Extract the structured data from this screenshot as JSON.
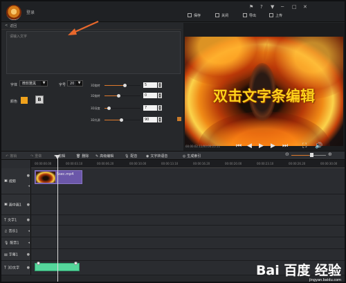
{
  "window": {
    "app_name": "登录",
    "buttons": {
      "save": "保存",
      "close": "关闭",
      "export": "导出",
      "upload": "上传"
    },
    "controls": [
      "⚑",
      "?",
      "▼",
      "─",
      "□",
      "✕"
    ]
  },
  "editor": {
    "back_label": "返回",
    "text_placeholder": "请输入文字",
    "font_label": "字体",
    "font_value": "微软雅黑",
    "size_label": "字号",
    "size_value": "20",
    "color_label": "颜色",
    "color_value": "#f0a21c",
    "bold_label": "B",
    "sliders": [
      {
        "label": "3D旋转",
        "value": "5",
        "fill": 0.55
      },
      {
        "label": "3D旋转",
        "value": "0",
        "fill": 0.38
      },
      {
        "label": "3D深度",
        "value": "7",
        "fill": 0.12
      },
      {
        "label": "3D光源",
        "value": "90",
        "fill": 0.46
      }
    ]
  },
  "preview": {
    "video_text": "双击文字条编辑",
    "time_text": "00:00:02.11/00:00:25.11"
  },
  "toolbar": {
    "undo": "撤销",
    "redo": "重做",
    "cut": "剪辑",
    "delete": "删除",
    "edit_subtitle": "高级编辑",
    "dub": "配音",
    "text_to_speech": "文字转语音",
    "generate_subtitle": "生成索引"
  },
  "ruler": {
    "ticks": [
      "00:00:00.00",
      "00:00:03.10",
      "00:00:06.20",
      "00:00:10.00",
      "00:00:13.10",
      "00:00:16.20",
      "00:00:20.00",
      "00:00:23.10",
      "00:00:26.20",
      "00:00:30.00"
    ]
  },
  "tracks": [
    {
      "name": "视频",
      "icon": "▣"
    },
    {
      "name": "画中画1",
      "icon": "▣"
    },
    {
      "name": "文字1",
      "icon": "T"
    },
    {
      "name": "音乐1",
      "icon": "♫"
    },
    {
      "name": "配音1",
      "icon": "🎙"
    },
    {
      "name": "字幕1",
      "icon": "▤"
    },
    {
      "name": "3D文字",
      "icon": "T"
    }
  ],
  "clips": {
    "video_name": "5sec.mp4"
  },
  "watermark": {
    "logo": "Bai 百度 经验",
    "url": "jingyan.baidu.com"
  }
}
